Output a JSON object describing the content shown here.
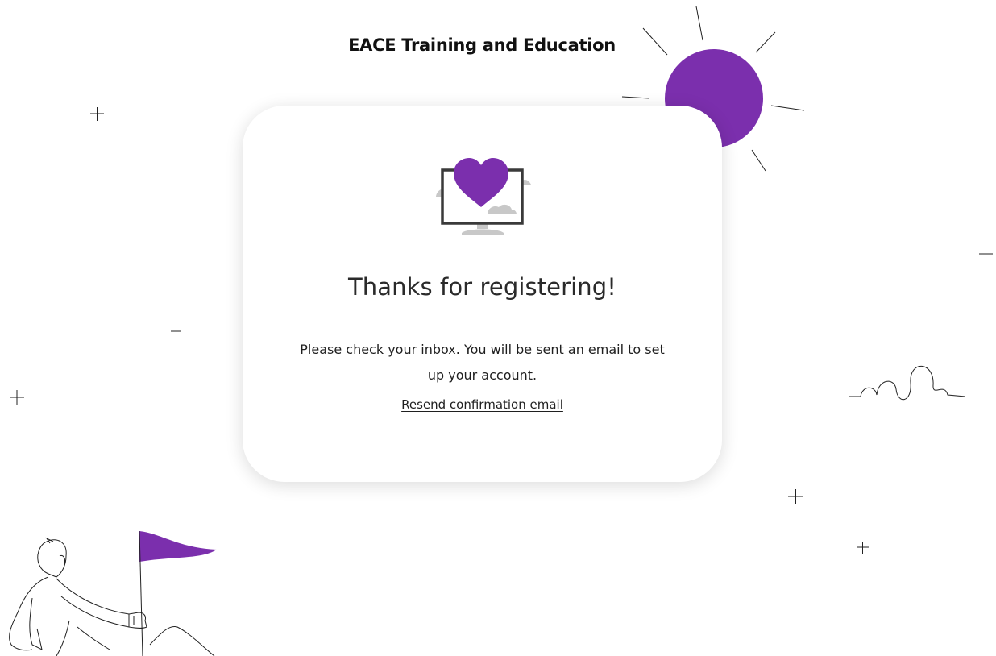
{
  "site": {
    "title": "EACE Training and Education"
  },
  "card": {
    "heading": "Thanks for registering!",
    "message": "Please check your inbox. You will be sent an email to set up your account.",
    "resend_link": "Resend confirmation email",
    "illustration_icon": "heart-monitor-icon"
  },
  "decorations": {
    "sun": "sun-illustration",
    "person": "person-with-flag-illustration",
    "squiggle": "squiggle-line",
    "sparkles": "plus-sparkle-icon"
  },
  "colors": {
    "accent": "#7b2fad",
    "text": "#1f1f1f",
    "cloud": "#c8c8c8",
    "monitor": "#3a3a3a"
  }
}
